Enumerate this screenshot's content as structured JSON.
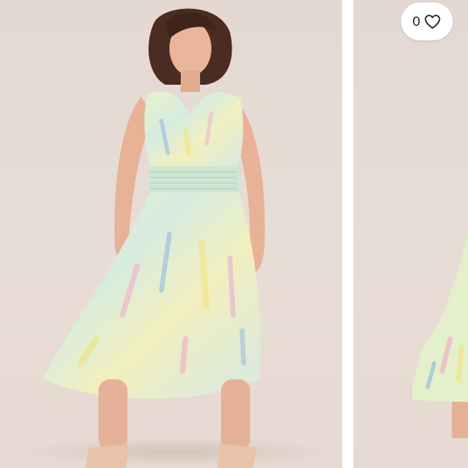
{
  "listing": {
    "like_count": "0"
  },
  "icons": {
    "like": "heart-icon"
  },
  "colors": {
    "background_backdrop": "#e5d9d2",
    "button_bg": "#ffffff",
    "text": "#222222"
  }
}
